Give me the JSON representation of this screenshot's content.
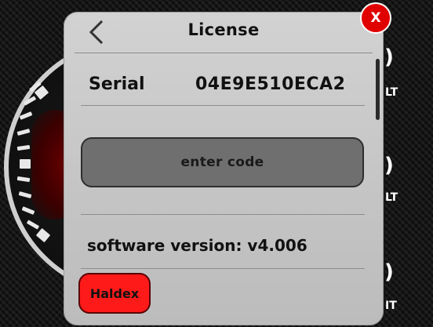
{
  "dialog": {
    "title": "License",
    "serial_label": "Serial",
    "serial_value": "04E9E510ECA2",
    "enter_code_label": "enter code",
    "version_text": "software version: v4.006"
  },
  "haldex_button": {
    "label": "Haldex"
  },
  "close_button": {
    "label": "X"
  },
  "background_readouts": {
    "r1_big": ")",
    "r1_small": "LT",
    "r2_big": ")",
    "r2_small": "LT",
    "r3_big": ")",
    "r3_small": "IT"
  },
  "icons": {
    "back": "back-chevron-icon",
    "close": "close-icon"
  },
  "colors": {
    "dialog_bg": "#c8c8c8",
    "enter_code_bg": "#6f6f6f",
    "haldex_red": "#ff1a1a",
    "close_red": "#e00000"
  }
}
